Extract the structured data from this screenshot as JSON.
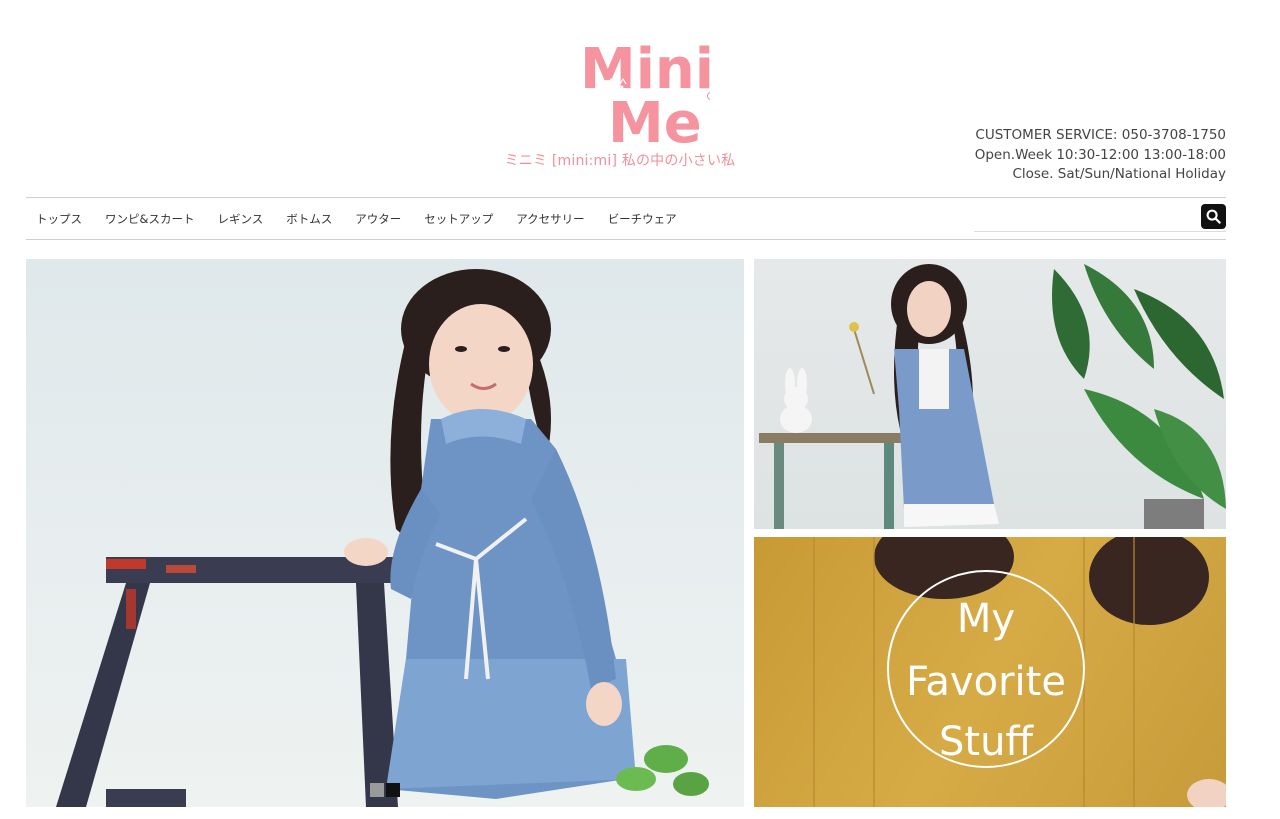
{
  "brand": {
    "logo_line1": "Mini",
    "logo_line2": "Me",
    "tagline": "ミニミ [mini:mi] 私の中の小さい私",
    "color": "#f5939f"
  },
  "customer_service": {
    "line1": "CUSTOMER SERVICE: 050-3708-1750",
    "line2": "Open.Week 10:30-12:00   13:00-18:00",
    "line3": "Close. Sat/Sun/National Holiday"
  },
  "nav": {
    "items": [
      {
        "label": "トップス"
      },
      {
        "label": "ワンピ&スカート"
      },
      {
        "label": "レギンス"
      },
      {
        "label": "ボトムス"
      },
      {
        "label": "アウター"
      },
      {
        "label": "セットアップ"
      },
      {
        "label": "アクセサリー"
      },
      {
        "label": "ビーチウェア"
      }
    ]
  },
  "search": {
    "placeholder": "",
    "value": "",
    "icon": "search-icon"
  },
  "banners": {
    "side_bottom_text": [
      "My",
      "Favorite",
      "Stuff"
    ]
  },
  "slider": {
    "count": 2,
    "active_index": 1
  }
}
